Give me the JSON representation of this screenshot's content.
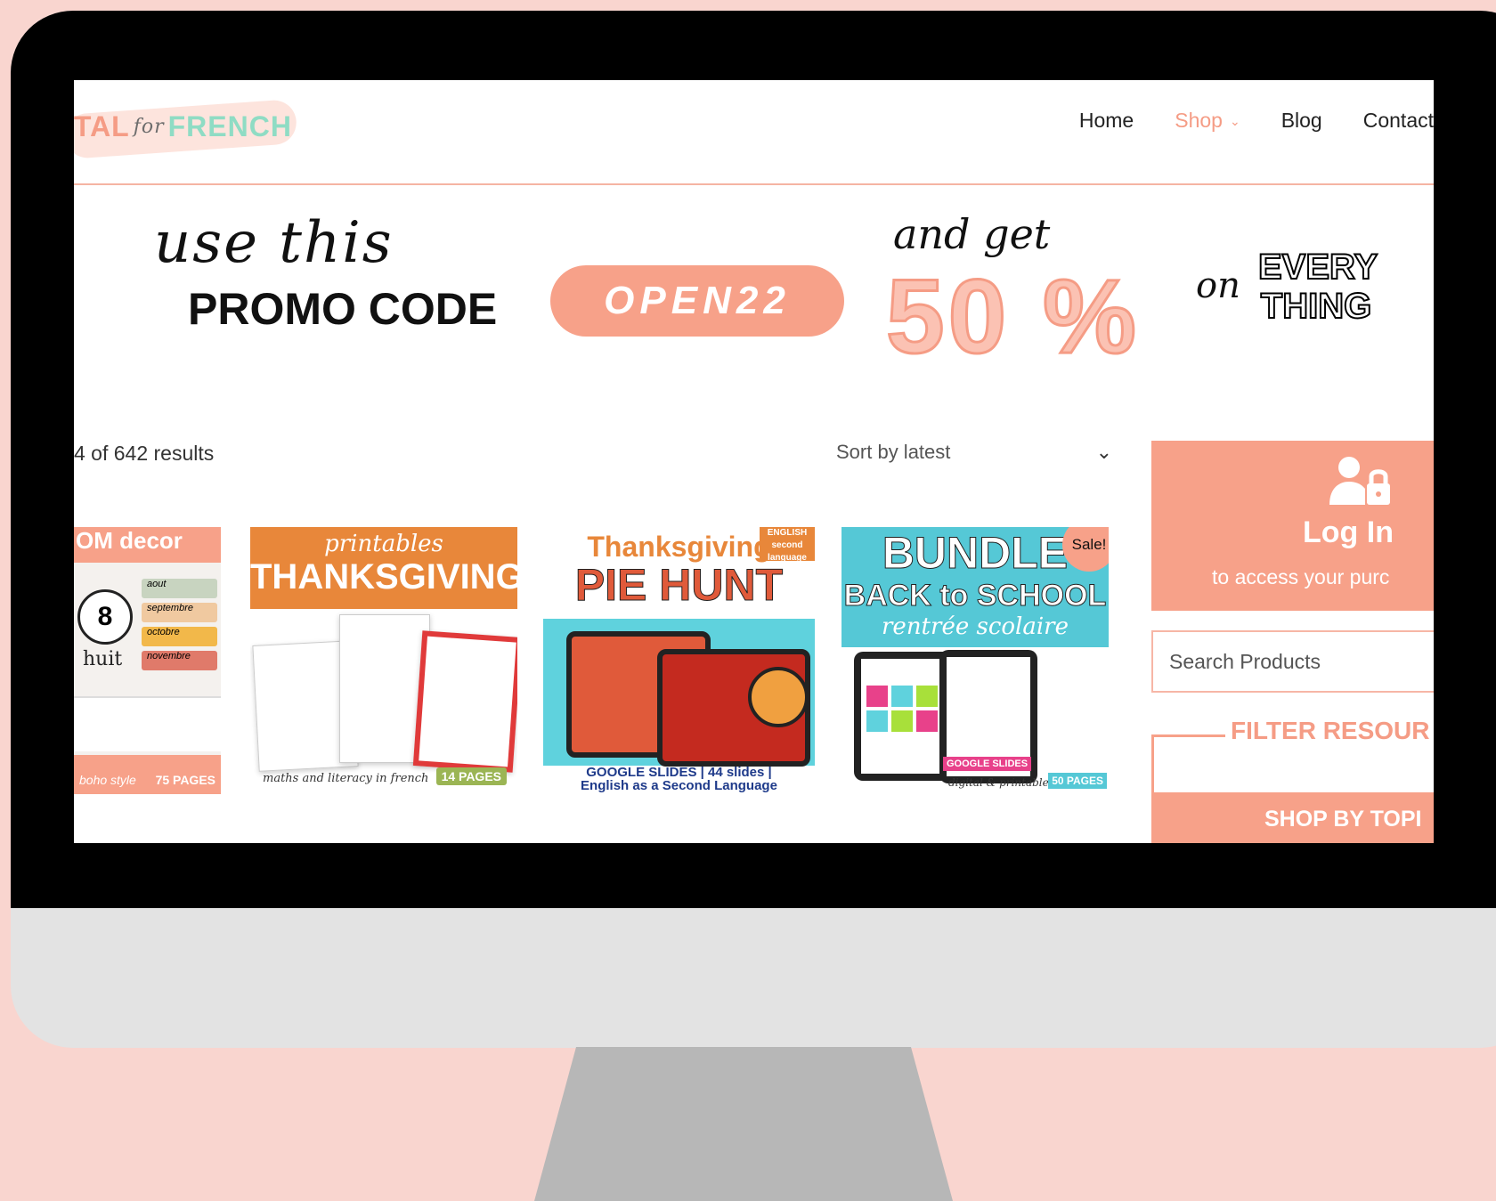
{
  "header": {
    "logo": {
      "part1": "ITAL",
      "part2": "for",
      "part3": "FRENCH"
    },
    "nav": [
      {
        "label": "Home",
        "active": false
      },
      {
        "label": "Shop",
        "active": true
      },
      {
        "label": "Blog",
        "active": false
      },
      {
        "label": "Contact",
        "active": false
      }
    ]
  },
  "promo": {
    "script_text": "use this",
    "label": "PROMO CODE",
    "code": "OPEN22",
    "get_text": "and get",
    "discount": "50 %",
    "on_text": "on",
    "every_text": "EVERY",
    "thing_text": "THING"
  },
  "results": {
    "count_text": "4 of 642 results",
    "sort_label": "Sort by latest"
  },
  "products": [
    {
      "title_top": "OM decor",
      "tag": "boho style",
      "pages": "75 PAGES",
      "clock_number": "8",
      "clock_word": "huit",
      "months": [
        "aout",
        "septembre",
        "octobre",
        "novembre"
      ]
    },
    {
      "line1": "printables",
      "line2": "THANKSGIVING",
      "caption": "maths and literacy in french",
      "pages": "14 PAGES"
    },
    {
      "line1": "Thanksgiving",
      "line2": "PIE HUNT",
      "lang": "ENGLISH second language",
      "caption1": "GOOGLE SLIDES | 44 slides |",
      "caption2": "English as a Second Language"
    },
    {
      "line1": "BUNDLE",
      "line2": "BACK to SCHOOL",
      "line3": "rentrée scolaire",
      "sale": "Sale!",
      "gs": "GOOGLE SLIDES",
      "caption": "digital & printable",
      "pages": "50 PAGES"
    }
  ],
  "sidebar": {
    "login_title": "Log In",
    "login_sub": "to access your purc",
    "search_placeholder": "Search Products",
    "filter_label": "FILTER RESOUR",
    "shop_topic": "SHOP BY TOPI"
  },
  "colors": {
    "accent": "#f7a189",
    "mint": "#8fdcc4",
    "bg": "#f9d5cf"
  }
}
